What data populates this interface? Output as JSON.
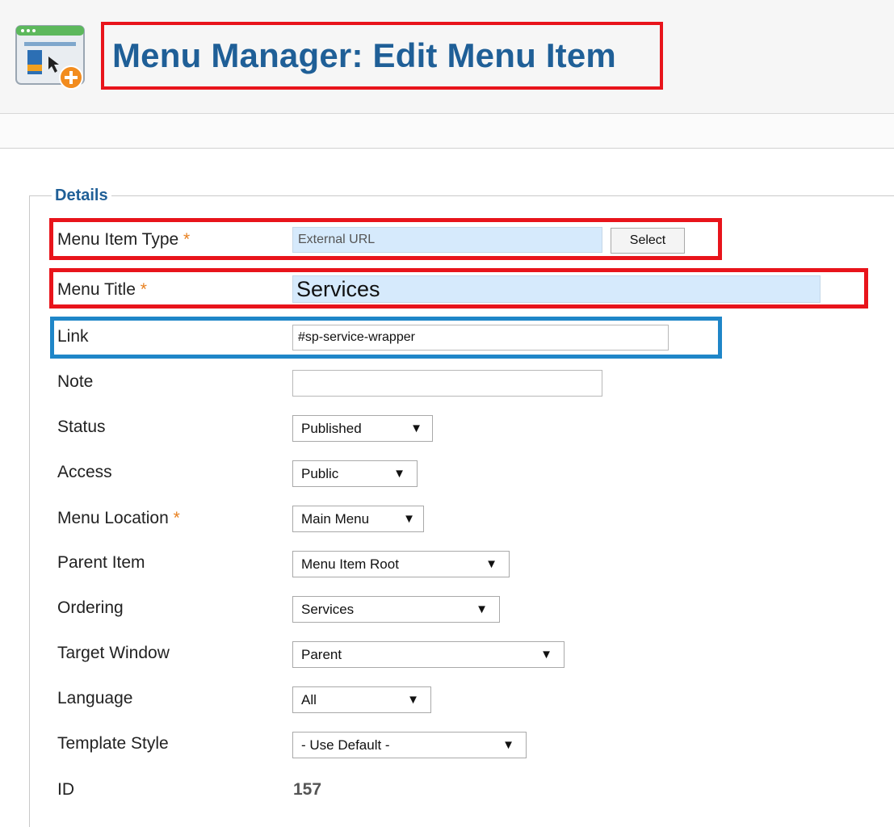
{
  "header": {
    "title": "Menu Manager: Edit Menu Item",
    "icon": "menu-item-add-icon"
  },
  "details": {
    "legend": "Details",
    "required_marker": "*",
    "menu_item_type": {
      "label": "Menu Item Type",
      "value": "External URL",
      "button": "Select"
    },
    "menu_title": {
      "label": "Menu Title",
      "value": "Services"
    },
    "link": {
      "label": "Link",
      "value": "#sp-service-wrapper"
    },
    "note": {
      "label": "Note",
      "value": ""
    },
    "status": {
      "label": "Status",
      "value": "Published"
    },
    "access": {
      "label": "Access",
      "value": "Public"
    },
    "menu_location": {
      "label": "Menu Location",
      "value": "Main Menu"
    },
    "parent_item": {
      "label": "Parent Item",
      "value": "Menu Item Root"
    },
    "ordering": {
      "label": "Ordering",
      "value": "Services"
    },
    "target_window": {
      "label": "Target Window",
      "value": "Parent"
    },
    "language": {
      "label": "Language",
      "value": "All"
    },
    "template_style": {
      "label": "Template Style",
      "value": "- Use Default -"
    },
    "id": {
      "label": "ID",
      "value": "157"
    }
  },
  "colors": {
    "title": "#1f5f97",
    "highlight_red": "#e8141b",
    "highlight_blue": "#1f86c8",
    "readonly_field": "#d6eafc",
    "required": "#e8801f"
  }
}
